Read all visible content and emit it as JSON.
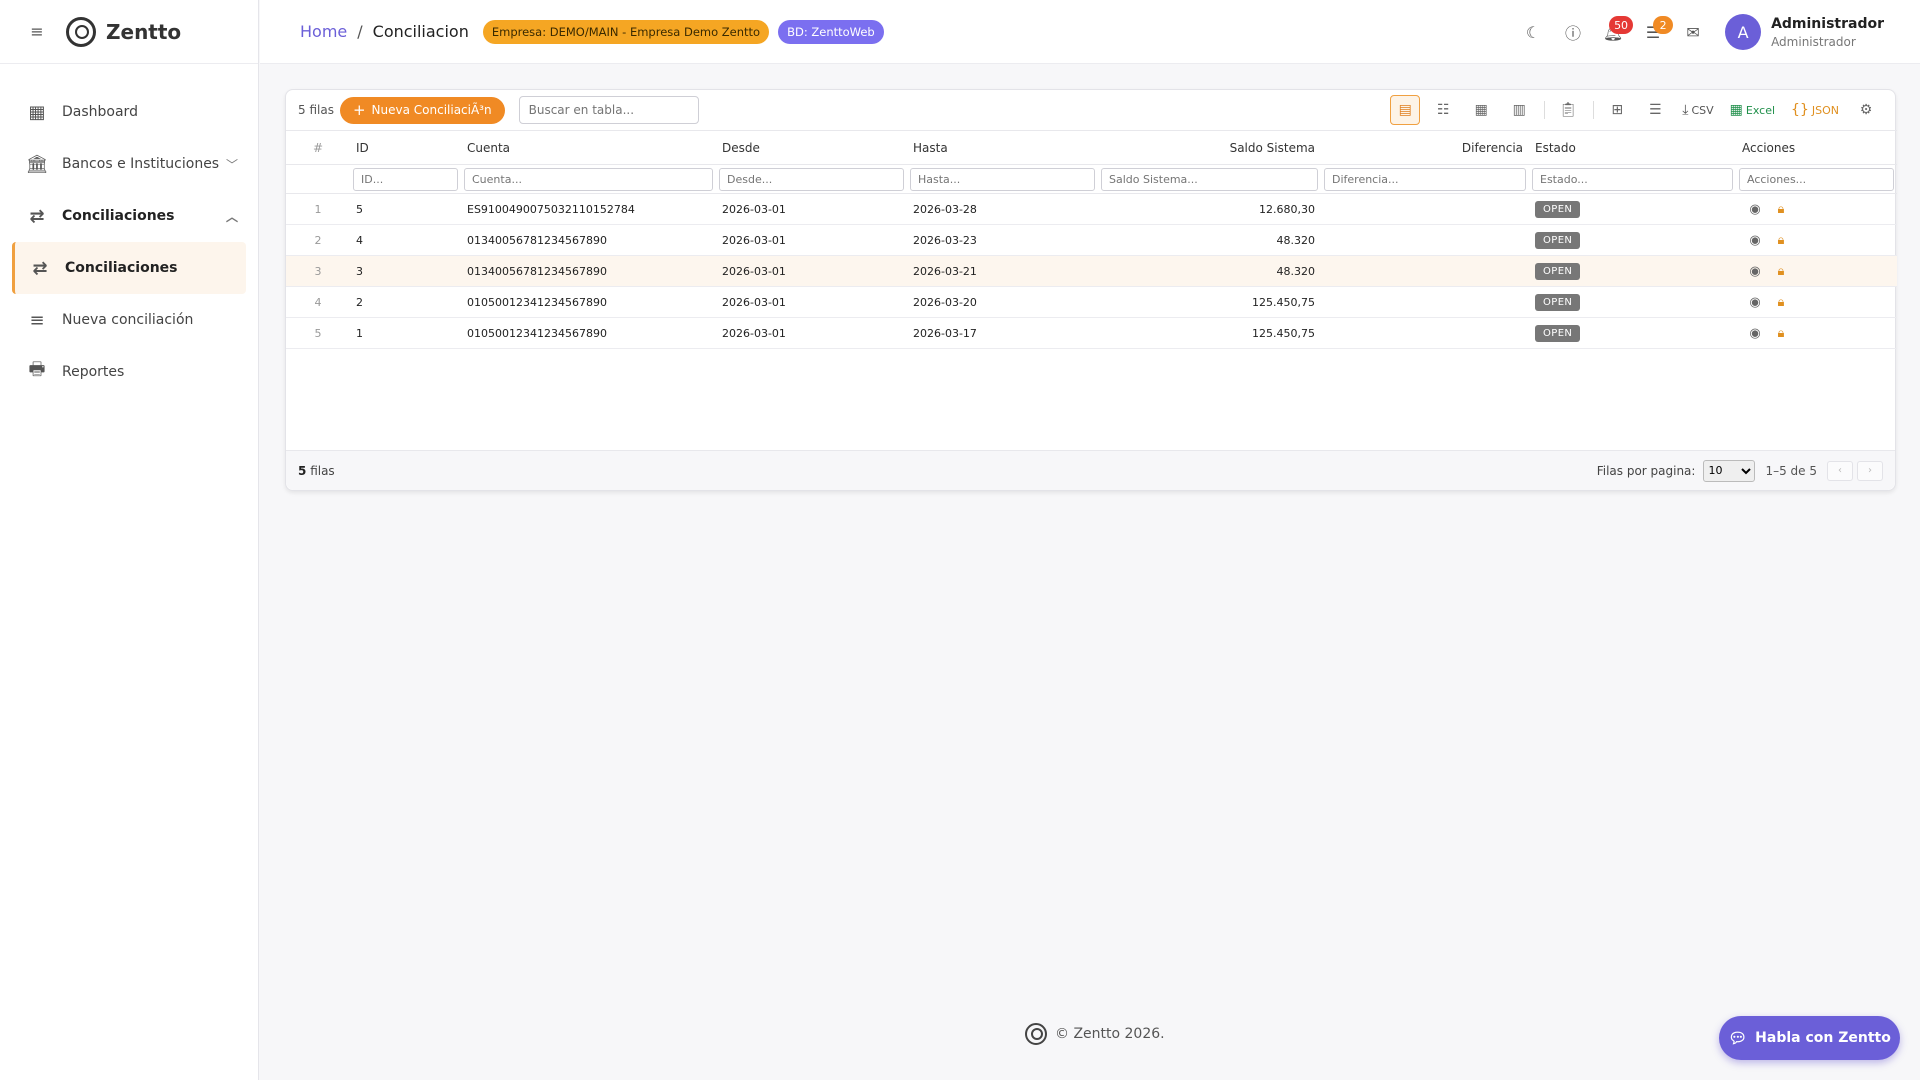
{
  "brand": {
    "name": "Zentto"
  },
  "sidebar": {
    "items": [
      {
        "label": "Dashboard",
        "icon": "dashboard-icon",
        "glyph": "▦"
      },
      {
        "label": "Bancos e Instituciones",
        "icon": "bank-icon",
        "glyph": "🏛"
      },
      {
        "label": "Conciliaciones",
        "icon": "compare-arrows-icon",
        "glyph": "⇄"
      },
      {
        "label": "Conciliaciones",
        "icon": "compare-arrows-icon",
        "glyph": "⇄"
      },
      {
        "label": "Nueva conciliación",
        "icon": "playlist-check-icon",
        "glyph": "≡"
      },
      {
        "label": "Reportes",
        "icon": "printer-icon",
        "glyph": "🖶"
      }
    ]
  },
  "header": {
    "breadcrumb_home": "Home",
    "breadcrumb_sep": "/",
    "breadcrumb_current": "Conciliacion",
    "company_chip": "Empresa: DEMO/MAIN - Empresa Demo Zentto",
    "db_chip": "BD: ZenttoWeb",
    "notifications_count": "50",
    "tasks_count": "2",
    "user_name": "Administrador",
    "user_role": "Administrador",
    "avatar_initial": "A"
  },
  "toolbar": {
    "rows_label": "5 filas",
    "new_button_label": "Nueva ConciliaciÃ³n",
    "search_placeholder": "Buscar en tabla...",
    "csv_label": "CSV",
    "excel_label": "Excel",
    "json_label": "JSON"
  },
  "table": {
    "columns": [
      "#",
      "ID",
      "Cuenta",
      "Desde",
      "Hasta",
      "Saldo Sistema",
      "Diferencia",
      "Estado",
      "Acciones"
    ],
    "filters": [
      "ID...",
      "Cuenta...",
      "Desde...",
      "Hasta...",
      "Saldo Sistema...",
      "Diferencia...",
      "Estado...",
      "Acciones..."
    ],
    "rows": [
      {
        "n": "1",
        "id": "5",
        "cuenta": "ES9100490075032110152784",
        "desde": "2026-03-01",
        "hasta": "2026-03-28",
        "saldo": "12.680,30",
        "diferencia": "",
        "estado": "OPEN"
      },
      {
        "n": "2",
        "id": "4",
        "cuenta": "01340056781234567890",
        "desde": "2026-03-01",
        "hasta": "2026-03-23",
        "saldo": "48.320",
        "diferencia": "",
        "estado": "OPEN"
      },
      {
        "n": "3",
        "id": "3",
        "cuenta": "01340056781234567890",
        "desde": "2026-03-01",
        "hasta": "2026-03-21",
        "saldo": "48.320",
        "diferencia": "",
        "estado": "OPEN"
      },
      {
        "n": "4",
        "id": "2",
        "cuenta": "01050012341234567890",
        "desde": "2026-03-01",
        "hasta": "2026-03-20",
        "saldo": "125.450,75",
        "diferencia": "",
        "estado": "OPEN"
      },
      {
        "n": "5",
        "id": "1",
        "cuenta": "01050012341234567890",
        "desde": "2026-03-01",
        "hasta": "2026-03-17",
        "saldo": "125.450,75",
        "diferencia": "",
        "estado": "OPEN"
      }
    ]
  },
  "pagination": {
    "rows_total_bold": "5",
    "rows_total_text": "filas",
    "per_page_label": "Filas por pagina:",
    "per_page_value": "10",
    "range": "1–5 de 5"
  },
  "footer": {
    "copyright": "© Zentto 2026."
  },
  "chat": {
    "label": "Habla con Zentto"
  },
  "colors": {
    "accent": "#f08a24",
    "primary": "#6b5fd8",
    "status_gray": "#777777"
  }
}
